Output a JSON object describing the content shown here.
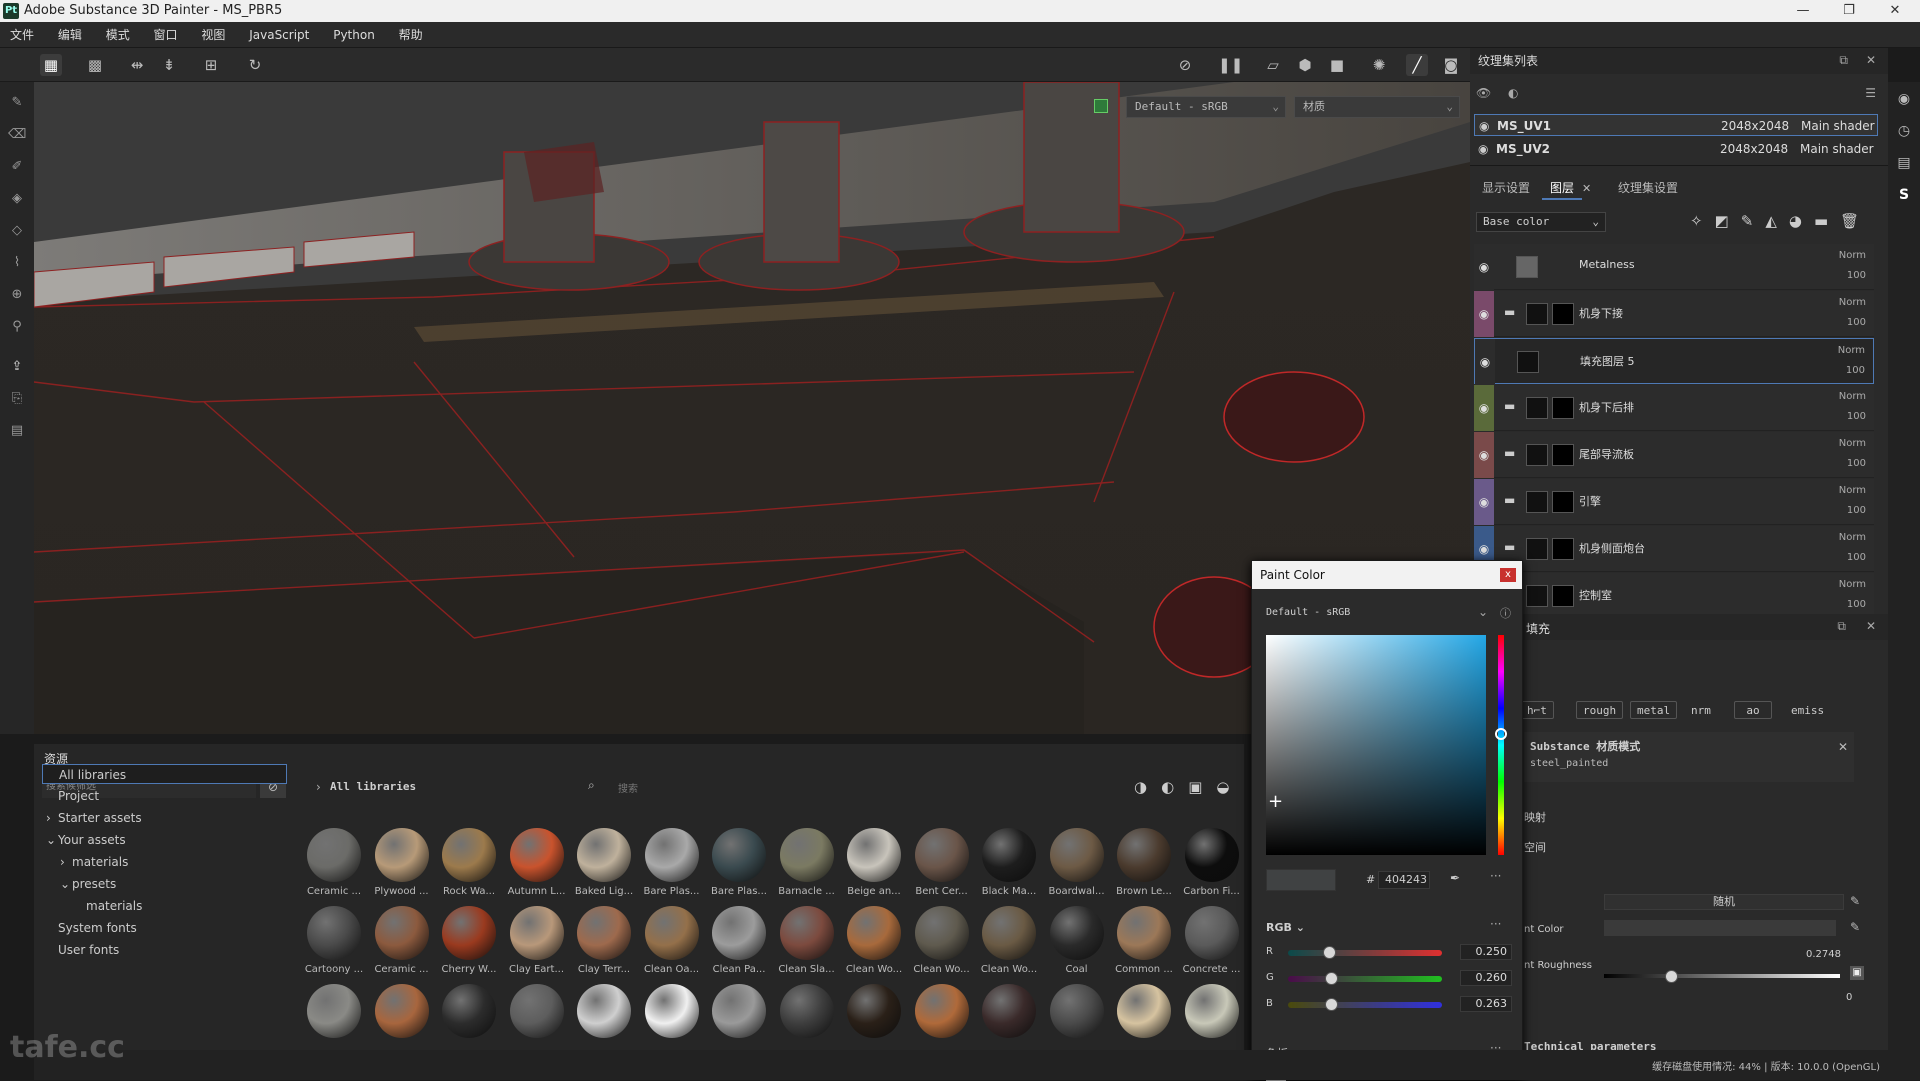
{
  "window": {
    "title": "Adobe Substance 3D Painter - MS_PBR5",
    "logo_text": "Pt"
  },
  "menu": [
    "文件",
    "编辑",
    "模式",
    "窗口",
    "视图",
    "JavaScript",
    "Python",
    "帮助"
  ],
  "viewport": {
    "color_profile": "Default - sRGB",
    "channel_select": "材质"
  },
  "texture_set_list": {
    "title": "纹理集列表",
    "rows": [
      {
        "name": "MS_UV1",
        "size": "2048x2048",
        "shader": "Main shader",
        "selected": true
      },
      {
        "name": "MS_UV2",
        "size": "2048x2048",
        "shader": "Main shader",
        "selected": false
      }
    ]
  },
  "layers": {
    "tabs": [
      "显示设置",
      "图层",
      "纹理集设置"
    ],
    "active_tab": "图层",
    "channel": "Base color",
    "items": [
      {
        "name": "Metalness",
        "blend": "Norm",
        "opacity": "100",
        "type": "fill"
      },
      {
        "name": "机身下接",
        "blend": "Norm",
        "opacity": "100",
        "type": "folder"
      },
      {
        "name": "填充图层 5",
        "blend": "Norm",
        "opacity": "100",
        "type": "fill",
        "selected": true
      },
      {
        "name": "机身下后排",
        "blend": "Norm",
        "opacity": "100",
        "type": "folder"
      },
      {
        "name": "尾部导流板",
        "blend": "Norm",
        "opacity": "100",
        "type": "folder"
      },
      {
        "name": "引擎",
        "blend": "Norm",
        "opacity": "100",
        "type": "folder"
      },
      {
        "name": "机身侧面炮台",
        "blend": "Norm",
        "opacity": "100",
        "type": "folder"
      },
      {
        "name": "控制室",
        "blend": "Norm",
        "opacity": "100",
        "type": "folder"
      }
    ]
  },
  "fill": {
    "title": "填充",
    "channels": [
      "h⌐t",
      "rough",
      "metal",
      "nrm",
      "ao",
      "emiss"
    ],
    "material_mode_label": "Substance 材质模式",
    "material_name": "steel_painted",
    "rows": [
      "映射",
      "空间"
    ],
    "random_label": "随机",
    "paint_color_label": "nt Color",
    "roughness_label": "nt Roughness",
    "roughness_value": "0.2748",
    "roughness_fraction": 0.2748,
    "zero_value": "0",
    "tech_params": "Technical parameters"
  },
  "assets": {
    "title": "资源",
    "filter_placeholder": "搜索候筛选",
    "breadcrumb": "All libraries",
    "search_placeholder": "搜索",
    "tree": [
      {
        "label": "All libraries",
        "indent": 0,
        "selected": true,
        "arrow": ""
      },
      {
        "label": "Project",
        "indent": 0,
        "arrow": ""
      },
      {
        "label": "Starter assets",
        "indent": 0,
        "arrow": "›"
      },
      {
        "label": "Your assets",
        "indent": 0,
        "arrow": "⌄"
      },
      {
        "label": "materials",
        "indent": 1,
        "arrow": "›"
      },
      {
        "label": "presets",
        "indent": 1,
        "arrow": "⌄"
      },
      {
        "label": "materials",
        "indent": 2,
        "arrow": ""
      },
      {
        "label": "System fonts",
        "indent": 0,
        "arrow": ""
      },
      {
        "label": "User fonts",
        "indent": 0,
        "arrow": ""
      }
    ],
    "materials_row1": [
      {
        "label": "Ceramic ...",
        "color": "#6b6b68"
      },
      {
        "label": "Plywood ...",
        "color": "#b79a78"
      },
      {
        "label": "Rock Wa...",
        "color": "#9c7a4c"
      },
      {
        "label": "Autumn L...",
        "color": "#c9532d"
      },
      {
        "label": "Baked Lig...",
        "color": "#bfb19c"
      },
      {
        "label": "Bare Plas...",
        "color": "#a9a9a9"
      },
      {
        "label": "Bare Plas...",
        "color": "#3a4a4f"
      },
      {
        "label": "Barnacle ...",
        "color": "#7b7a62"
      },
      {
        "label": "Beige an...",
        "color": "#c8c4bb"
      },
      {
        "label": "Bent Cer...",
        "color": "#6a5549"
      },
      {
        "label": "Black Ma...",
        "color": "#1d1d1d"
      },
      {
        "label": "Boardwal...",
        "color": "#6d5a45"
      },
      {
        "label": "Brown Le...",
        "color": "#4b3b2e"
      },
      {
        "label": "Carbon Fi...",
        "color": "#0d0d0d"
      }
    ],
    "materials_row2": [
      {
        "label": "Cartoony ...",
        "color": "#4a4a4a"
      },
      {
        "label": "Ceramic ...",
        "color": "#8c5a3e"
      },
      {
        "label": "Cherry W...",
        "color": "#9a3a1f"
      },
      {
        "label": "Clay Eart...",
        "color": "#b8987a"
      },
      {
        "label": "Clay Terr...",
        "color": "#9e6a4d"
      },
      {
        "label": "Clean Oa...",
        "color": "#94704a"
      },
      {
        "label": "Clean Pa...",
        "color": "#9c9c9c"
      },
      {
        "label": "Clean Sla...",
        "color": "#7c4a3e"
      },
      {
        "label": "Clean Wo...",
        "color": "#a86a3c"
      },
      {
        "label": "Clean Wo...",
        "color": "#5f5a4e"
      },
      {
        "label": "Clean Wo...",
        "color": "#6a5a44"
      },
      {
        "label": "Coal",
        "color": "#2a2a2a"
      },
      {
        "label": "Common ...",
        "color": "#9c7858"
      },
      {
        "label": "Concrete ...",
        "color": "#5a5a5a"
      }
    ],
    "materials_row3": [
      "#8a8a86",
      "#a8663e",
      "#2c2c2c",
      "#5d5d5d",
      "#cfcfcf",
      "#f0f0f0",
      "#9a9a9a",
      "#3e3e3e",
      "#2a2018",
      "#b06a3a",
      "#3a2a2a",
      "#4a4a4a",
      "#d6c3a0",
      "#c8c8b8"
    ]
  },
  "paint_color": {
    "title": "Paint Color",
    "close": "x",
    "profile": "Default - sRGB",
    "hex": "404243",
    "hash": "#",
    "mode": "RGB",
    "r": "0.250",
    "g": "0.260",
    "b": "0.263",
    "r_value": 0.25,
    "g_value": 0.26,
    "b_value": 0.263,
    "hue_fraction": 0.45,
    "swatches_label": "色板",
    "add": "+"
  },
  "statusbar": {
    "text": "缓存磁盘使用情况: 44% | 版本: 10.0.0 (OpenGL)"
  },
  "watermark": "tafe.cc"
}
